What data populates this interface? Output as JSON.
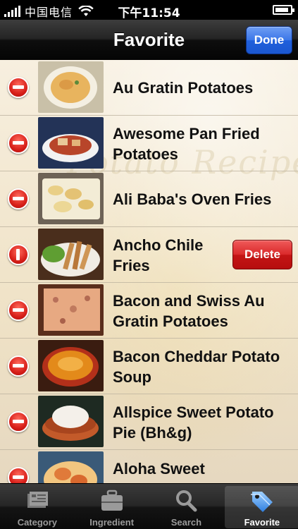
{
  "status_bar": {
    "carrier": "中国电信",
    "time": "下午11:54",
    "icons": [
      "signal-icon",
      "wifi-icon",
      "battery-icon"
    ]
  },
  "nav_bar": {
    "title": "Favorite",
    "done_label": "Done"
  },
  "watermark_text": "Potato Recipes",
  "recipes": [
    {
      "title": "Au Gratin Potatoes",
      "thumb_colors": [
        "#c9b07a",
        "#e8c07a",
        "#f4efe2"
      ]
    },
    {
      "title": "Awesome Pan Fried Potatoes",
      "thumb_colors": [
        "#2a3a60",
        "#b8452a",
        "#e8c898"
      ]
    },
    {
      "title": "Ali Baba's Oven Fries",
      "thumb_colors": [
        "#6d6256",
        "#e9d79c",
        "#f3ecd6"
      ]
    },
    {
      "title": "Ancho Chile Fries",
      "thumb_colors": [
        "#5e3b24",
        "#c58a4a",
        "#6aa03a"
      ],
      "delete_label": "Delete"
    },
    {
      "title": "Bacon and Swiss Au Gratin Potatoes",
      "thumb_colors": [
        "#5a2e1c",
        "#e7a982",
        "#b8705a"
      ]
    },
    {
      "title": "Bacon Cheddar Potato Soup",
      "thumb_colors": [
        "#3a1c10",
        "#e38a1a",
        "#b3301a"
      ]
    },
    {
      "title": "Allspice Sweet Potato Pie (Bh&g)",
      "thumb_colors": [
        "#1e2a22",
        "#c35a2a",
        "#f4f0ea"
      ]
    },
    {
      "title": "Aloha Sweet",
      "thumb_colors": [
        "#3a5a78",
        "#e07a3a",
        "#f2c680"
      ]
    }
  ],
  "tab_bar": {
    "tabs": [
      {
        "label": "Category",
        "icon": "category-icon"
      },
      {
        "label": "Ingredient",
        "icon": "ingredient-icon"
      },
      {
        "label": "Search",
        "icon": "search-icon"
      },
      {
        "label": "Favorite",
        "icon": "favorite-tag-icon",
        "selected": true
      }
    ]
  },
  "colors": {
    "done_button": "#2a66dc",
    "delete_button": "#c81c1c",
    "minus_icon": "#d8201a",
    "selected_tab_label": "#ffffff",
    "tab_label": "#9a9a9a"
  }
}
